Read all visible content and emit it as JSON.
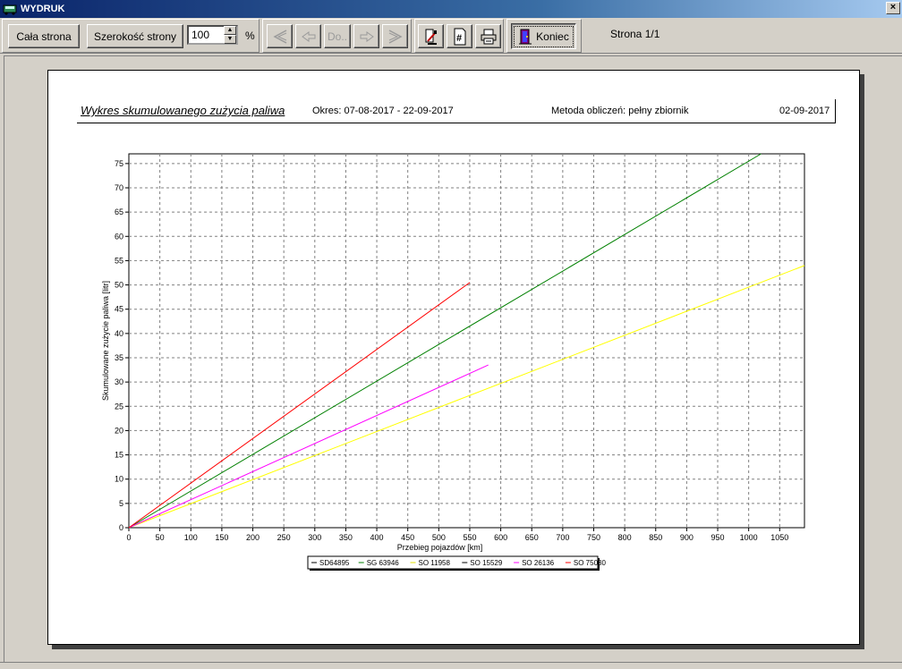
{
  "window": {
    "title": "WYDRUK",
    "close_glyph": "×"
  },
  "toolbar": {
    "full_page_label": "Cała strona",
    "page_width_label": "Szerokość strony",
    "zoom_value": "100",
    "zoom_unit": "%",
    "nav_first_icon": "first-page-icon",
    "nav_prev_icon": "prev-page-icon",
    "goto_label": "Do..",
    "nav_next_icon": "next-page-icon",
    "nav_last_icon": "last-page-icon",
    "print_setup_icon": "print-setup-icon",
    "page_number_icon": "page-number-icon",
    "print_icon": "printer-icon",
    "close_label": "Koniec",
    "page_info": "Strona 1/1"
  },
  "report": {
    "title": "Wykres skumulowanego zużycia paliwa",
    "period": "Okres: 07-08-2017 - 22-09-2017",
    "method": "Metoda obliczeń: pełny zbiornik",
    "date": "02-09-2017"
  },
  "chart_data": {
    "type": "line",
    "xlabel": "Przebieg pojazdów  [km]",
    "ylabel": "Skumulowane zużycie paliwa [litr]",
    "xlim": [
      0,
      1090
    ],
    "ylim": [
      0,
      77
    ],
    "xticks": [
      0,
      50,
      100,
      150,
      200,
      250,
      300,
      350,
      400,
      450,
      500,
      550,
      600,
      650,
      700,
      750,
      800,
      850,
      900,
      950,
      1000,
      1050
    ],
    "yticks": [
      0,
      5,
      10,
      15,
      20,
      25,
      30,
      35,
      40,
      45,
      50,
      55,
      60,
      65,
      70,
      75
    ],
    "grid": true,
    "legend_position": "bottom",
    "series": [
      {
        "name": "SD64895",
        "color": "#000000",
        "x": [],
        "y": []
      },
      {
        "name": "SG 63946",
        "color": "#008000",
        "x": [
          0,
          1020
        ],
        "y": [
          0,
          77
        ]
      },
      {
        "name": "SO 11958",
        "color": "#ffff00",
        "x": [
          0,
          1090
        ],
        "y": [
          0,
          54
        ]
      },
      {
        "name": "SO 15529",
        "color": "#000000",
        "x": [],
        "y": []
      },
      {
        "name": "SO 26136",
        "color": "#ff00ff",
        "x": [
          0,
          580
        ],
        "y": [
          0,
          33.5
        ]
      },
      {
        "name": "SO 75030",
        "color": "#ff0000",
        "x": [
          0,
          550
        ],
        "y": [
          0,
          50.5
        ]
      }
    ]
  }
}
